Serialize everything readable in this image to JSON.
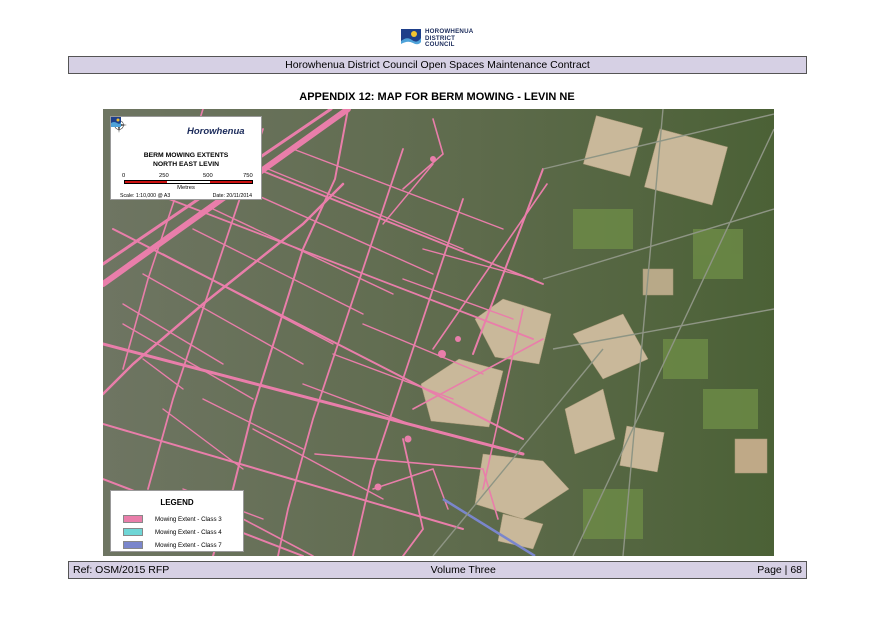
{
  "logo": {
    "lines": [
      "HOROWHENUA",
      "DISTRICT",
      "COUNCIL"
    ],
    "icon": "council-logo-icon"
  },
  "header": {
    "banner": "Horowhenua District Council Open Spaces Maintenance Contract"
  },
  "heading": "APPENDIX 12:  MAP FOR BERM MOWING - LEVIN NE",
  "map": {
    "brand": "Horowhenua",
    "title_lines": [
      "BERM MOWING EXTENTS",
      "NORTH EAST LEVIN"
    ],
    "scale_ticks": [
      "0",
      "250",
      "500",
      "750"
    ],
    "scale_units": "Metres",
    "scale_ratio": "Scale: 1:10,000 @ A3",
    "date": "Date: 20/11/2014",
    "icons": [
      "compass-rose-icon",
      "council-logo-icon"
    ],
    "colors": {
      "class3": "#e97eaa",
      "class4": "#6fd6d6",
      "class7": "#7a86cc",
      "scale_red": "#cc1111"
    }
  },
  "legend": {
    "title": "LEGEND",
    "items": [
      {
        "label": "Mowing Extent - Class 3",
        "color": "#e97eaa"
      },
      {
        "label": "Mowing Extent - Class 4",
        "color": "#6fd6d6"
      },
      {
        "label": "Mowing Extent - Class 7",
        "color": "#7a86cc"
      }
    ]
  },
  "footer": {
    "ref": "Ref: OSM/2015 RFP",
    "volume": "Volume Three",
    "page": "Page | 68"
  }
}
